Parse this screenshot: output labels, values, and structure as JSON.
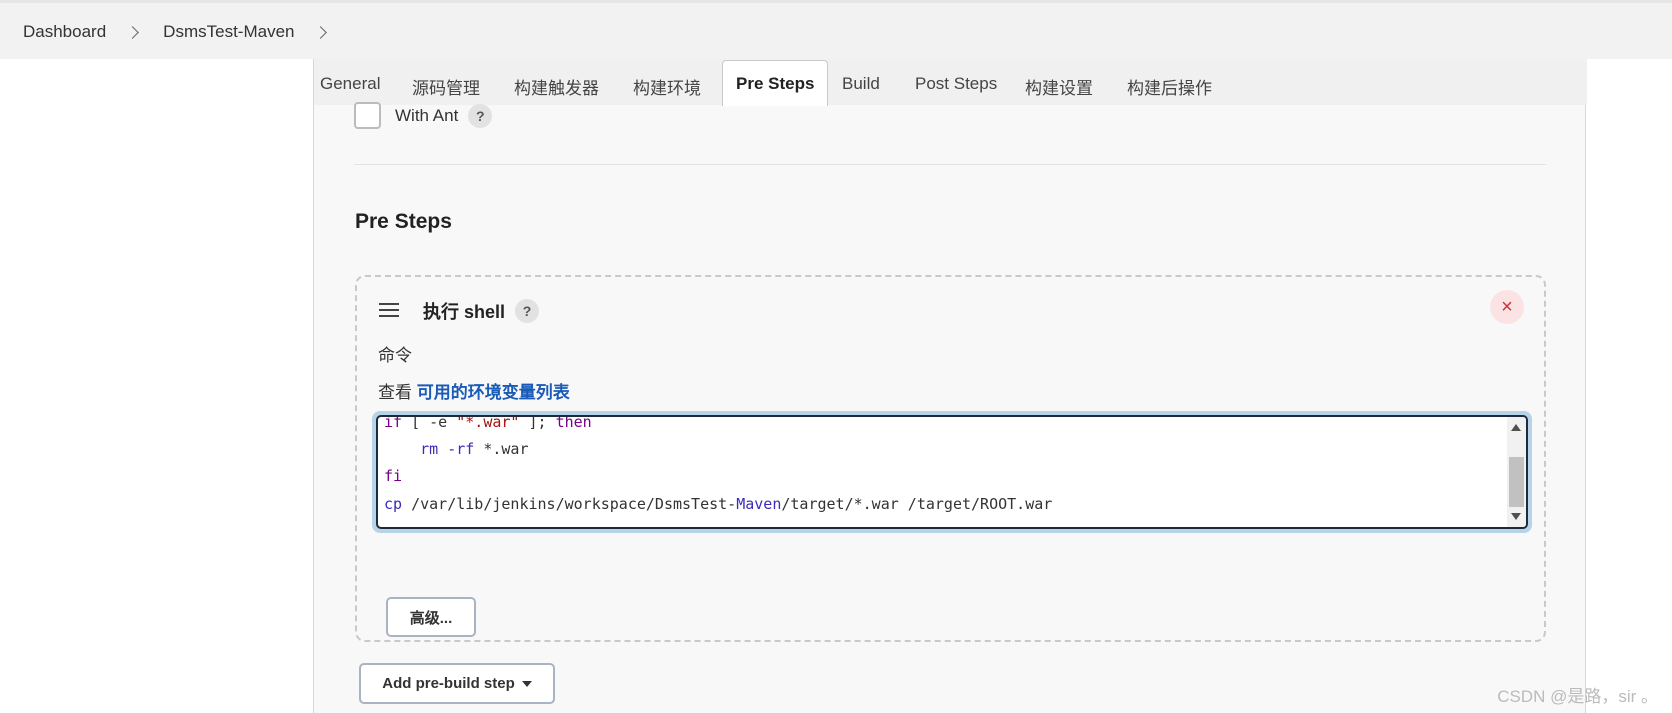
{
  "breadcrumb": {
    "items": [
      "Dashboard",
      "DsmsTest-Maven"
    ]
  },
  "tabs": [
    {
      "label": "General"
    },
    {
      "label": "源码管理"
    },
    {
      "label": "构建触发器"
    },
    {
      "label": "构建环境"
    },
    {
      "label": "Pre Steps",
      "active": true
    },
    {
      "label": "Build"
    },
    {
      "label": "Post Steps"
    },
    {
      "label": "构建设置"
    },
    {
      "label": "构建后操作"
    }
  ],
  "with_ant": {
    "label": "With Ant",
    "checked": false,
    "help": "?"
  },
  "pre_steps": {
    "title": "Pre Steps",
    "step": {
      "title": "执行 shell",
      "help": "?",
      "close_icon": "×",
      "command_label": "命令",
      "env_prefix": "查看 ",
      "env_link": "可用的环境变量列表",
      "code": {
        "line1_if": "if",
        "line1_rest": " [ -e ",
        "line1_str": "\"*.war\"",
        "line1_end": " ]; ",
        "line1_then": "then",
        "line2_indent": "    ",
        "line2_cmd": "rm",
        "line2_flag": " -rf",
        "line2_rest": " *.war",
        "line3": "fi",
        "line4_cmd": "cp",
        "line4_a": " /var/lib/jenkins/workspace/DsmsTest-",
        "line4_b": "Maven",
        "line4_c": "/target/*.war /target/ROOT.war"
      },
      "advanced_button": "高级..."
    },
    "add_button": "Add pre-build step"
  },
  "watermark": "CSDN @是路，sir 。"
}
